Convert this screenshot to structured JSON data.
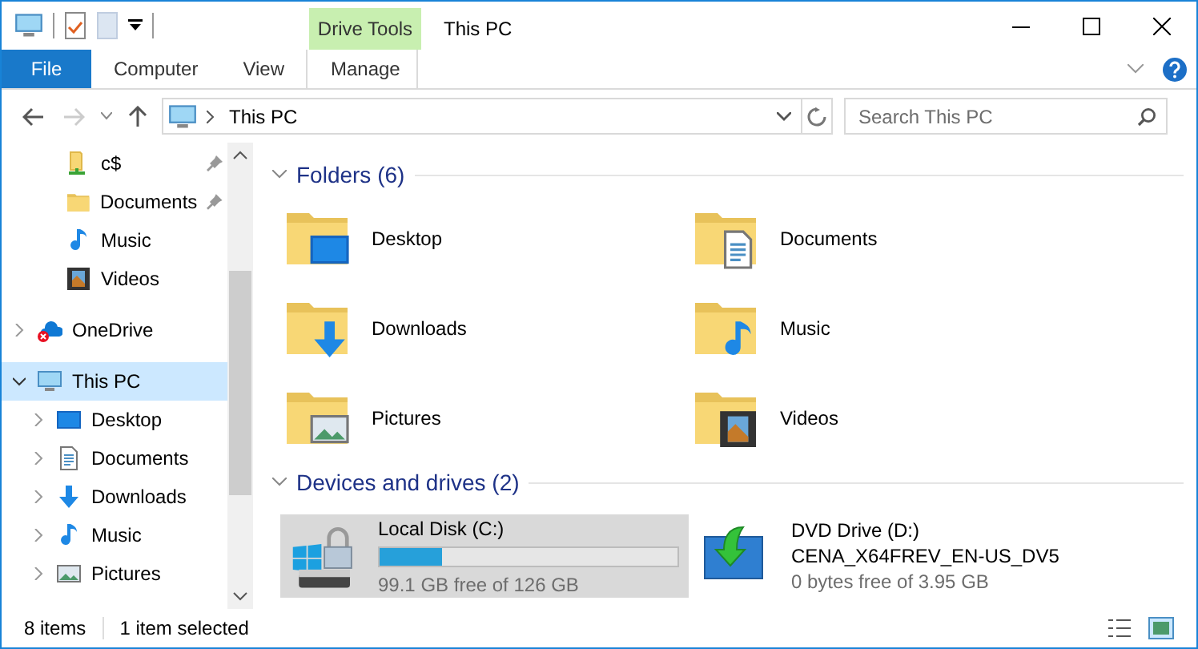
{
  "window": {
    "title": "This PC",
    "context_group": "Drive Tools"
  },
  "ribbon": {
    "tabs": [
      {
        "label": "File",
        "kind": "file"
      },
      {
        "label": "Computer",
        "kind": "normal"
      },
      {
        "label": "View",
        "kind": "normal"
      },
      {
        "label": "Manage",
        "kind": "contextual"
      }
    ]
  },
  "address": {
    "path": "This PC"
  },
  "search": {
    "placeholder": "Search This PC"
  },
  "sidebar": {
    "items": [
      {
        "label": "c$",
        "kind": "share",
        "pinned": true,
        "selected": false
      },
      {
        "label": "Documents",
        "kind": "folder",
        "pinned": true,
        "selected": false
      },
      {
        "label": "Music",
        "kind": "music",
        "pinned": false,
        "selected": false
      },
      {
        "label": "Videos",
        "kind": "videos",
        "pinned": false,
        "selected": false
      },
      {
        "label": "OneDrive",
        "kind": "onedrive",
        "expanded": false,
        "selected": false
      },
      {
        "label": "This PC",
        "kind": "pc",
        "expanded": true,
        "selected": true,
        "children": [
          {
            "label": "Desktop",
            "kind": "desktop",
            "expanded": false,
            "selected": false
          },
          {
            "label": "Documents",
            "kind": "documents",
            "expanded": false,
            "selected": false
          },
          {
            "label": "Downloads",
            "kind": "downloads",
            "expanded": false,
            "selected": false
          },
          {
            "label": "Music",
            "kind": "music",
            "expanded": false,
            "selected": false
          },
          {
            "label": "Pictures",
            "kind": "pictures",
            "expanded": false,
            "selected": false
          }
        ]
      }
    ]
  },
  "content": {
    "groups": [
      {
        "title": "Folders (6)",
        "expanded": true,
        "kind": "folders",
        "items": [
          {
            "label": "Desktop",
            "kind": "desktop"
          },
          {
            "label": "Documents",
            "kind": "documents"
          },
          {
            "label": "Downloads",
            "kind": "downloads"
          },
          {
            "label": "Music",
            "kind": "music"
          },
          {
            "label": "Pictures",
            "kind": "pictures"
          },
          {
            "label": "Videos",
            "kind": "videos"
          }
        ]
      },
      {
        "title": "Devices and drives (2)",
        "expanded": true,
        "kind": "drives",
        "items": [
          {
            "label": "Local Disk (C:)",
            "kind": "disk",
            "selected": true,
            "level": 0.21,
            "free": "99.1 GB free of 126 GB"
          },
          {
            "label": "DVD Drive (D:)",
            "kind": "dvd",
            "selected": false,
            "volume": "CENA_X64FREV_EN-US_DV5",
            "free": "0 bytes free of 3.95 GB"
          }
        ]
      }
    ]
  },
  "status_bar": {
    "count": "8 items",
    "selection": "1 item selected"
  }
}
